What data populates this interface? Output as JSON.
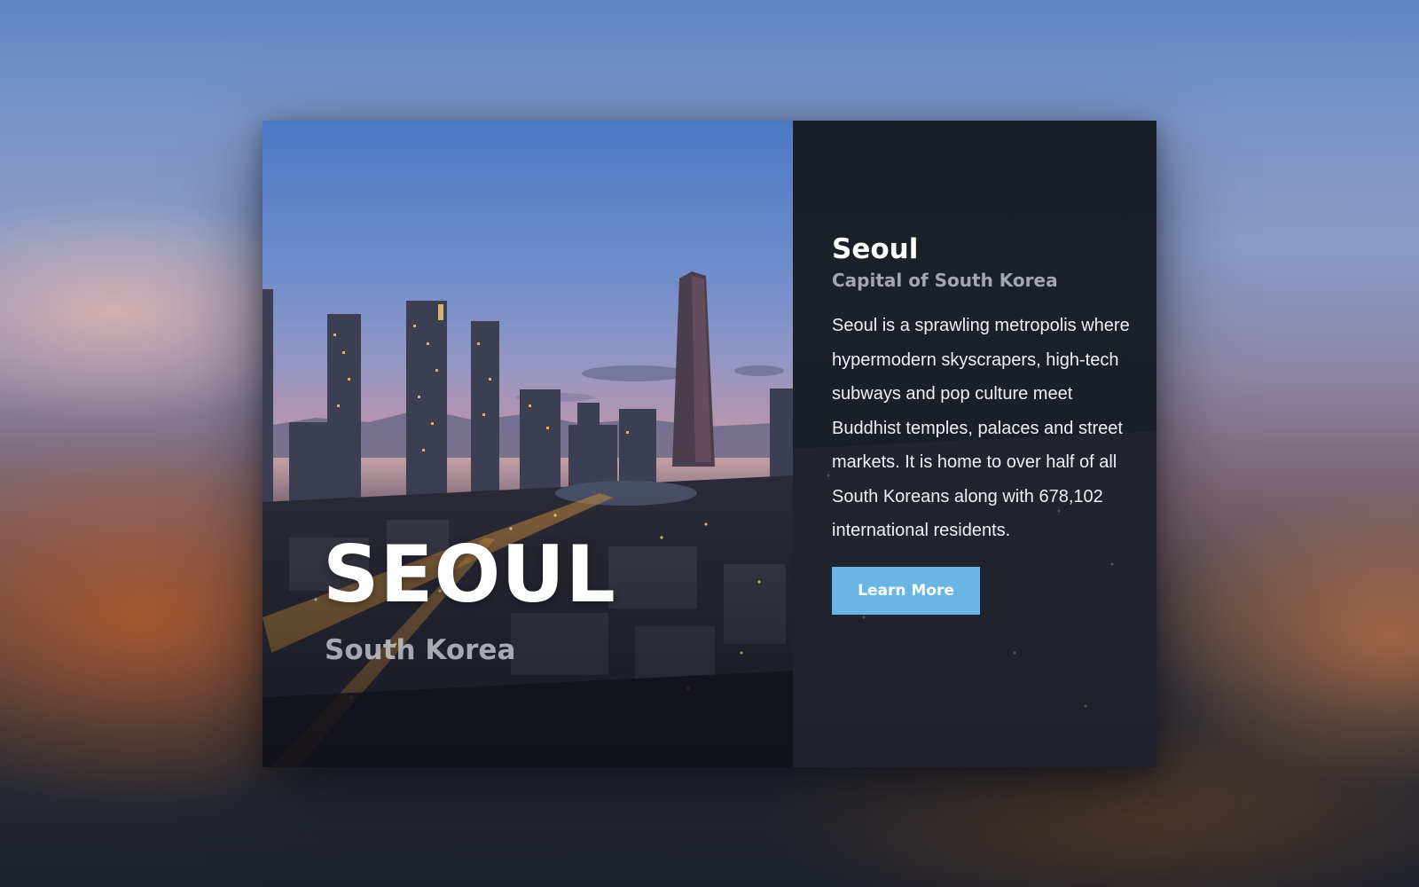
{
  "hero": {
    "title": "SEOUL",
    "subtitle": "South Korea"
  },
  "info": {
    "title": "Seoul",
    "subtitle": "Capital of South Korea",
    "description": "Seoul is a sprawling metropolis where hypermodern skyscrapers, high-tech subways and pop culture meet Buddhist temples, palaces and street markets. It is home to over half of all South Koreans along with 678,102 international residents.",
    "button_label": "Learn More"
  },
  "colors": {
    "button": "#69b5e3",
    "panel": "#1a1f2a",
    "sky_top": "#4a79c4"
  }
}
